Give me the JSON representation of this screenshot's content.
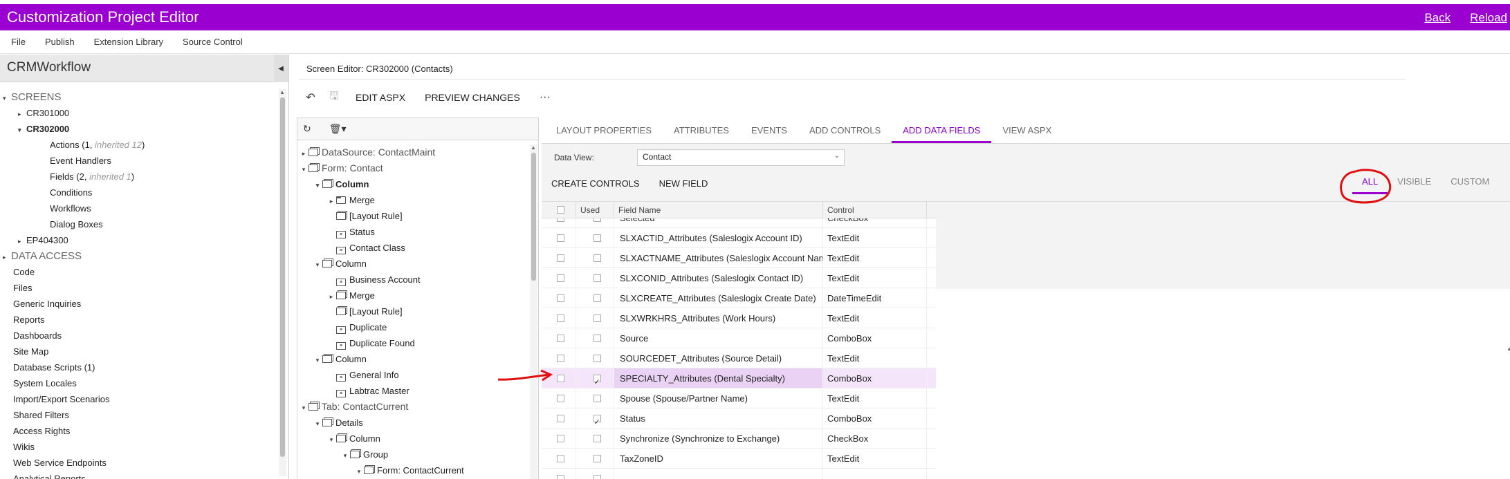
{
  "app": {
    "title": "Customization Project Editor",
    "links": [
      "Back",
      "Reload"
    ]
  },
  "menu": [
    "File",
    "Publish",
    "Extension Library",
    "Source Control"
  ],
  "project": {
    "name": "CRMWorkflow",
    "tree": [
      {
        "label": "SCREENS",
        "level": 0,
        "arrow": "▾",
        "kind": "sect"
      },
      {
        "label": "CR301000",
        "level": 1,
        "arrow": "▸"
      },
      {
        "label": "CR302000",
        "level": 1,
        "arrow": "▾",
        "bold": true
      },
      {
        "label": "Actions (1, ",
        "inh": "inherited 12",
        "tail": ")",
        "level": 2
      },
      {
        "label": "Event Handlers",
        "level": 2
      },
      {
        "label": "Fields (2, ",
        "inh": "inherited 1",
        "tail": ")",
        "level": 2
      },
      {
        "label": "Conditions",
        "level": 2
      },
      {
        "label": "Workflows",
        "level": 2
      },
      {
        "label": "Dialog Boxes",
        "level": 2
      },
      {
        "label": "EP404300",
        "level": 1,
        "arrow": "▸"
      },
      {
        "label": "DATA ACCESS",
        "level": 0,
        "arrow": "▸",
        "kind": "sect"
      },
      {
        "label": "Code",
        "level": 0
      },
      {
        "label": "Files",
        "level": 0
      },
      {
        "label": "Generic Inquiries",
        "level": 0
      },
      {
        "label": "Reports",
        "level": 0
      },
      {
        "label": "Dashboards",
        "level": 0
      },
      {
        "label": "Site Map",
        "level": 0
      },
      {
        "label": "Database Scripts (1)",
        "level": 0
      },
      {
        "label": "System Locales",
        "level": 0
      },
      {
        "label": "Import/Export Scenarios",
        "level": 0
      },
      {
        "label": "Shared Filters",
        "level": 0
      },
      {
        "label": "Access Rights",
        "level": 0
      },
      {
        "label": "Wikis",
        "level": 0
      },
      {
        "label": "Web Service Endpoints",
        "level": 0
      },
      {
        "label": "Analytical Reports",
        "level": 0
      }
    ]
  },
  "editor": {
    "title": "Screen Editor: CR302000 (Contacts)",
    "toolbar": {
      "undo_icon": "undo-icon",
      "save_icon": "save-icon",
      "edit_aspx": "EDIT ASPX",
      "preview": "PREVIEW CHANGES",
      "more": "···"
    }
  },
  "element_tree": {
    "toolbar": {
      "refresh_icon": "refresh-icon",
      "delete_icon": "trash-icon"
    },
    "rows": [
      {
        "label": "DataSource: ContactMaint",
        "level": 0,
        "arrow": "▸",
        "icon": "stack",
        "kind": "hdr"
      },
      {
        "label": "Form: Contact",
        "level": 0,
        "arrow": "▾",
        "icon": "stack",
        "kind": "hdr"
      },
      {
        "label": "Column",
        "level": 1,
        "arrow": "▾",
        "icon": "stack",
        "bold": true
      },
      {
        "label": "Merge",
        "level": 2,
        "arrow": "▸",
        "icon": "folder"
      },
      {
        "label": "[Layout Rule]",
        "level": 2,
        "icon": "stack"
      },
      {
        "label": "Status",
        "level": 2,
        "icon": "field"
      },
      {
        "label": "Contact Class",
        "level": 2,
        "icon": "field"
      },
      {
        "label": "Column",
        "level": 1,
        "arrow": "▾",
        "icon": "stack"
      },
      {
        "label": "Business Account",
        "level": 2,
        "icon": "field"
      },
      {
        "label": "Merge",
        "level": 2,
        "arrow": "▸",
        "icon": "stack"
      },
      {
        "label": "[Layout Rule]",
        "level": 2,
        "icon": "stack"
      },
      {
        "label": "Duplicate",
        "level": 2,
        "icon": "field"
      },
      {
        "label": "Duplicate Found",
        "level": 2,
        "icon": "field"
      },
      {
        "label": "Column",
        "level": 1,
        "arrow": "▾",
        "icon": "stack"
      },
      {
        "label": "General Info",
        "level": 2,
        "icon": "field"
      },
      {
        "label": "Labtrac Master",
        "level": 2,
        "icon": "field"
      },
      {
        "label": "Tab: ContactCurrent",
        "level": 0,
        "arrow": "▾",
        "icon": "stack",
        "kind": "hdr"
      },
      {
        "label": "Details",
        "level": 1,
        "arrow": "▾",
        "icon": "stack"
      },
      {
        "label": "Column",
        "level": 2,
        "arrow": "▾",
        "icon": "stack"
      },
      {
        "label": "Group",
        "level": 3,
        "arrow": "▾",
        "icon": "stack"
      },
      {
        "label": "Form: ContactCurrent",
        "level": 4,
        "arrow": "▾",
        "icon": "stack"
      }
    ]
  },
  "tabs": [
    "LAYOUT PROPERTIES",
    "ATTRIBUTES",
    "EVENTS",
    "ADD CONTROLS",
    "ADD DATA FIELDS",
    "VIEW ASPX"
  ],
  "active_tab": "ADD DATA FIELDS",
  "data_view": {
    "label": "Data View:",
    "value": "Contact"
  },
  "actions": [
    "CREATE CONTROLS",
    "NEW FIELD"
  ],
  "filters": [
    "ALL",
    "VISIBLE",
    "CUSTOM"
  ],
  "active_filter": "ALL",
  "grid": {
    "headers": {
      "used": "Used",
      "name": "Field Name",
      "control": "Control"
    },
    "rows": [
      {
        "used": false,
        "name": "Selected",
        "control": "CheckBox"
      },
      {
        "used": false,
        "name": "SLXACTID_Attributes (Saleslogix Account ID)",
        "control": "TextEdit"
      },
      {
        "used": false,
        "name": "SLXACTNAME_Attributes (Saleslogix Account Name)",
        "control": "TextEdit"
      },
      {
        "used": false,
        "name": "SLXCONID_Attributes (Saleslogix Contact ID)",
        "control": "TextEdit"
      },
      {
        "used": false,
        "name": "SLXCREATE_Attributes (Saleslogix Create Date)",
        "control": "DateTimeEdit"
      },
      {
        "used": false,
        "name": "SLXWRKHRS_Attributes (Work Hours)",
        "control": "TextEdit"
      },
      {
        "used": false,
        "name": "Source",
        "control": "ComboBox"
      },
      {
        "used": false,
        "name": "SOURCEDET_Attributes (Source Detail)",
        "control": "TextEdit"
      },
      {
        "used": true,
        "name": "SPECIALTY_Attributes (Dental Specialty)",
        "control": "ComboBox",
        "highlight": true
      },
      {
        "used": false,
        "name": "Spouse (Spouse/Partner Name)",
        "control": "TextEdit"
      },
      {
        "used": true,
        "name": "Status",
        "control": "ComboBox"
      },
      {
        "used": false,
        "name": "Synchronize (Synchronize to Exchange)",
        "control": "CheckBox"
      },
      {
        "used": false,
        "name": "TaxZoneID",
        "control": "TextEdit"
      },
      {
        "used": false,
        "name": "",
        "control": ""
      }
    ]
  },
  "colors": {
    "brand": "#9a00d0",
    "annotation": "#e01010"
  }
}
